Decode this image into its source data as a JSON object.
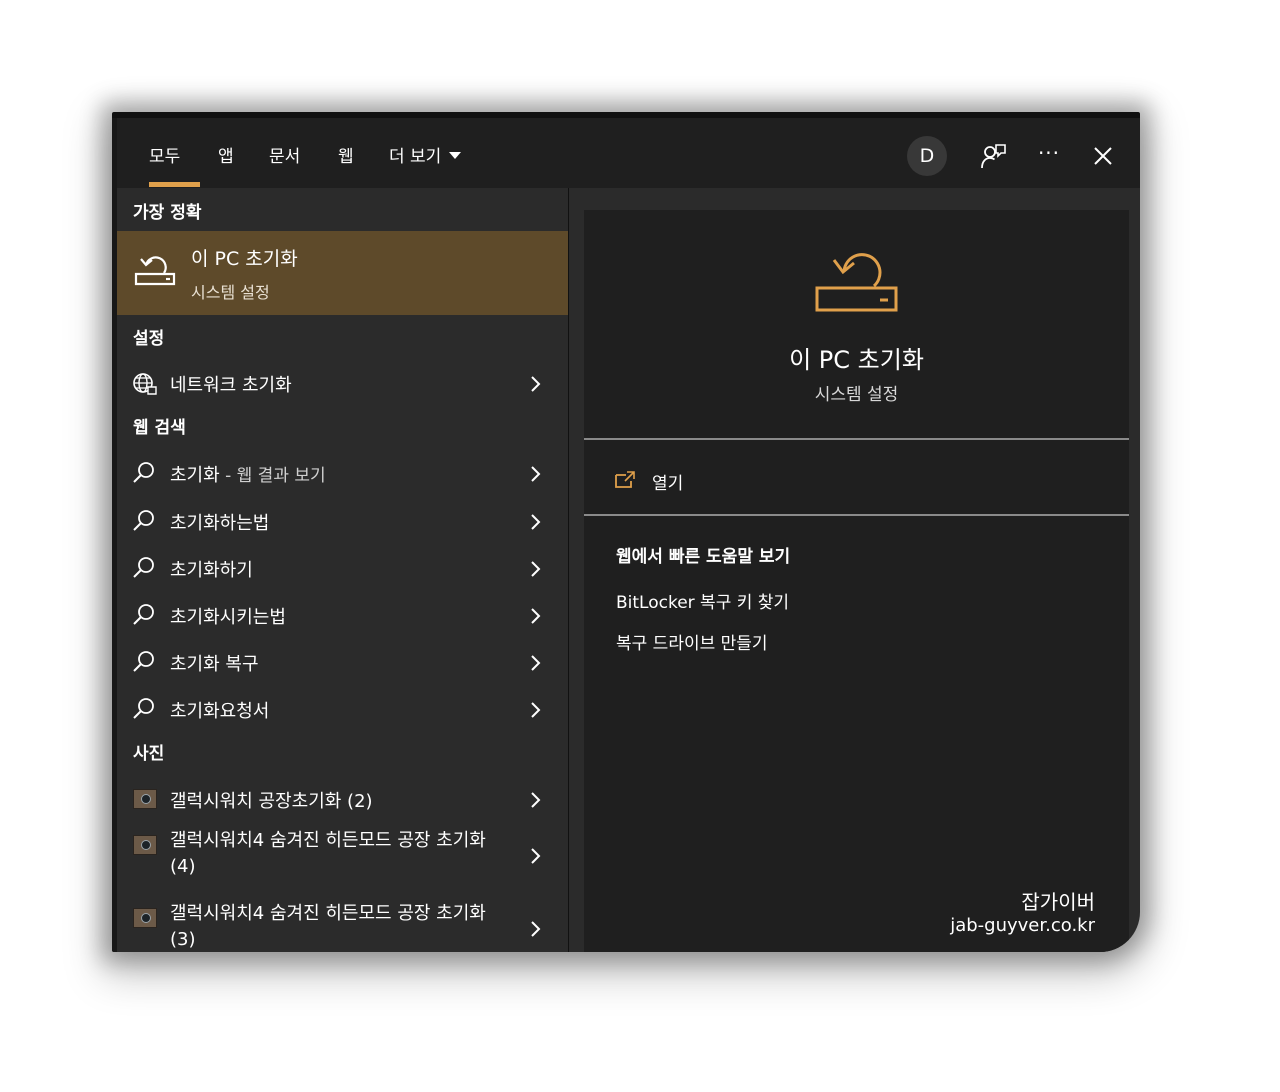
{
  "tabs": [
    {
      "label": "모두",
      "active": true
    },
    {
      "label": "앱"
    },
    {
      "label": "문서"
    },
    {
      "label": "웹"
    },
    {
      "label": "더 보기"
    }
  ],
  "account_initial": "D",
  "icons": {
    "feedback": "person-feedback-icon",
    "more": "ellipsis-icon",
    "close": "close-icon"
  },
  "more_glyph": "···",
  "colors": {
    "accent": "#e0a04b",
    "best_match_bg": "#5e4a2a",
    "panel_bg": "#2b2b2b",
    "detail_bg": "#1f1f1f"
  },
  "best_match": {
    "header": "가장 정확",
    "title": "이 PC 초기화",
    "subtitle": "시스템 설정"
  },
  "settings": {
    "header": "설정",
    "items": [
      {
        "label": "네트워크 초기화"
      }
    ]
  },
  "web_search": {
    "header": "웹 검색",
    "items": [
      {
        "label": "초기화",
        "suffix": " - 웹 결과 보기"
      },
      {
        "label": "초기화하는법"
      },
      {
        "label": "초기화하기"
      },
      {
        "label": "초기화시키는법"
      },
      {
        "label": "초기화 복구"
      },
      {
        "label": "초기화요청서"
      }
    ]
  },
  "photos": {
    "header": "사진",
    "items": [
      {
        "label": "갤럭시워치 공장초기화 (2)"
      },
      {
        "label": "갤럭시워치4 숨겨진 히든모드 공장 초기화 (4)"
      },
      {
        "label": "갤럭시워치4 숨겨진 히든모드 공장 초기화 (3)"
      }
    ]
  },
  "detail": {
    "title": "이 PC 초기화",
    "subtitle": "시스템 설정",
    "open_label": "열기",
    "help_header": "웹에서 빠른 도움말 보기",
    "links": [
      "BitLocker 복구 키 찾기",
      "복구 드라이브 만들기"
    ]
  },
  "watermark": {
    "line1": "잡가이버",
    "line2": "jab-guyver.co.kr"
  }
}
